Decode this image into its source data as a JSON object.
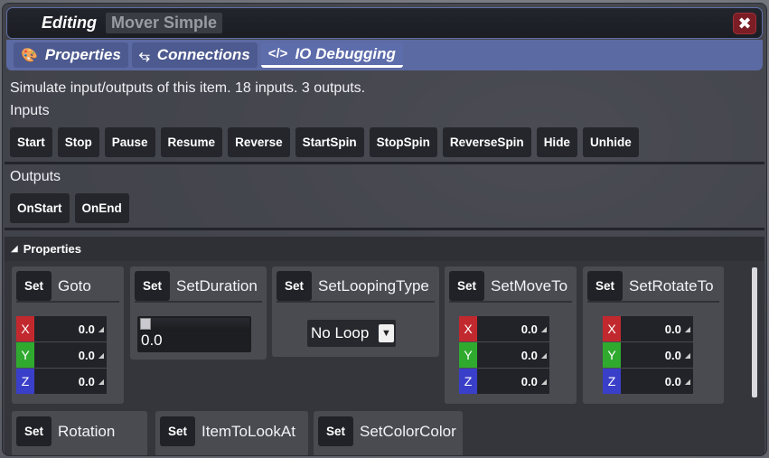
{
  "window": {
    "title_prefix": "Editing",
    "item_name": "Mover Simple"
  },
  "tabs": [
    {
      "label": "Properties",
      "icon": "palette-icon"
    },
    {
      "label": "Connections",
      "icon": "connections-icon"
    },
    {
      "label": "IO Debugging",
      "icon": "code-icon",
      "active": true
    }
  ],
  "info": "Simulate input/outputs of this item. 18 inputs. 3 outputs.",
  "inputs": {
    "label": "Inputs",
    "buttons": [
      "Start",
      "Stop",
      "Pause",
      "Resume",
      "Reverse",
      "StartSpin",
      "StopSpin",
      "ReverseSpin",
      "Hide",
      "Unhide"
    ]
  },
  "outputs": {
    "label": "Outputs",
    "buttons": [
      "OnStart",
      "OnEnd"
    ]
  },
  "properties": {
    "header": "Properties",
    "set_label": "Set",
    "cards": {
      "goto": {
        "title": "Goto",
        "x": "0.0",
        "y": "0.0",
        "z": "0.0"
      },
      "duration": {
        "title": "SetDuration",
        "value": "0.0",
        "slider_fraction": 0.0
      },
      "looping": {
        "title": "SetLoopingType",
        "selected": "No Loop"
      },
      "moveto": {
        "title": "SetMoveTo",
        "x": "0.0",
        "y": "0.0",
        "z": "0.0"
      },
      "rotateto": {
        "title": "SetRotateTo",
        "x": "0.0",
        "y": "0.0",
        "z": "0.0"
      },
      "rotation": {
        "title": "Rotation"
      },
      "lookat": {
        "title": "ItemToLookAt"
      },
      "color": {
        "title": "SetColorColor"
      }
    },
    "axes": {
      "x": "X",
      "y": "Y",
      "z": "Z"
    }
  },
  "colors": {
    "accent": "#5c6aa3",
    "close": "#7a1d24",
    "axis_x": "#c2292f",
    "axis_y": "#2faa2f",
    "axis_z": "#3a3fc9"
  }
}
